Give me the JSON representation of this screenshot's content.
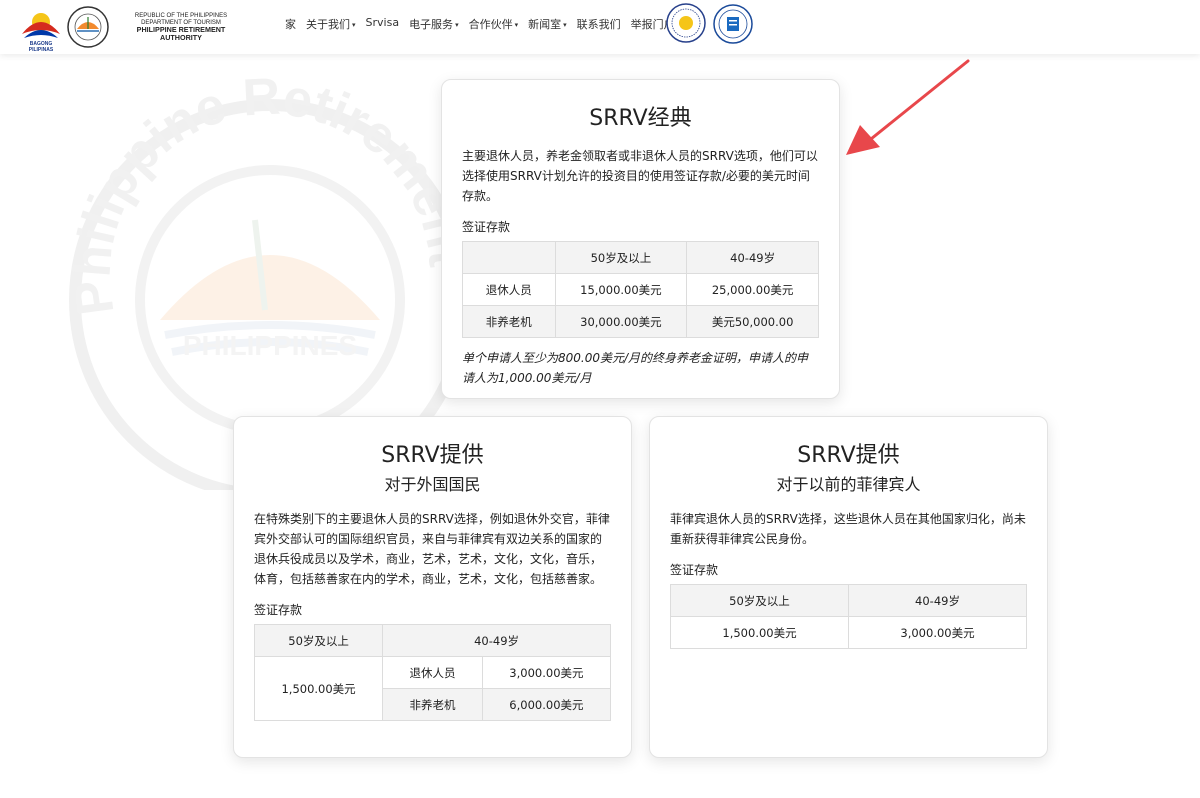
{
  "header": {
    "logo_bp_text": "BAGONG PILIPINAS",
    "org_line1": "REPUBLIC OF THE PHILIPPINES",
    "org_line2": "DEPARTMENT OF TOURISM",
    "org_line3": "PHILIPPINE RETIREMENT AUTHORITY",
    "nav": [
      {
        "label": "家",
        "dropdown": false
      },
      {
        "label": "关于我们",
        "dropdown": true
      },
      {
        "label": "Srvisa",
        "dropdown": false
      },
      {
        "label": "电子服务",
        "dropdown": true
      },
      {
        "label": "合作伙伴",
        "dropdown": true
      },
      {
        "label": "新闻室",
        "dropdown": true
      },
      {
        "label": "联系我们",
        "dropdown": false
      },
      {
        "label": "举报门户",
        "dropdown": false
      }
    ],
    "caret": "▾"
  },
  "watermark": {
    "text1": "Philippine Retirement",
    "text2": "PHILIPPINES"
  },
  "colors": {
    "arrow": "#e8474b",
    "border": "#dcdcdc",
    "header_fill": "#f3f3f3"
  },
  "classic": {
    "title": "SRRV经典",
    "desc": "主要退休人员，养老金领取者或非退休人员的SRRV选项，他们可以选择使用SRRV计划允许的投资目的使用签证存款/必要的美元时间存款。",
    "deposit_label": "签证存款",
    "table": {
      "headers": [
        "",
        "50岁及以上",
        "40-49岁"
      ],
      "rows": [
        [
          "退休人员",
          "15,000.00美元",
          "25,000.00美元"
        ],
        [
          "非养老机",
          "30,000.00美元",
          "美元50,000.00"
        ]
      ]
    },
    "note": "单个申请人至少为800.00美元/月的终身养老金证明，申请人的申请人为1,000.00美元/月"
  },
  "foreign": {
    "title": "SRRV提供",
    "subtitle": "对于外国国民",
    "desc": "在特殊类别下的主要退休人员的SRRV选择，例如退休外交官，菲律宾外交部认可的国际组织官员，来自与菲律宾有双边关系的国家的退休兵役成员以及学术，商业，艺术，艺术，文化，文化，音乐，体育，包括慈善家在内的学术，商业，艺术，文化，包括慈善家。",
    "deposit_label": "签证存款",
    "table": {
      "head_left": "50岁及以上",
      "head_right": "40-49岁",
      "left_value": "1,500.00美元",
      "rows": [
        [
          "退休人员",
          "3,000.00美元"
        ],
        [
          "非养老机",
          "6,000.00美元"
        ]
      ]
    }
  },
  "former": {
    "title": "SRRV提供",
    "subtitle": "对于以前的菲律宾人",
    "desc": "菲律宾退休人员的SRRV选择，这些退休人员在其他国家归化，尚未重新获得菲律宾公民身份。",
    "deposit_label": "签证存款",
    "table": {
      "headers": [
        "50岁及以上",
        "40-49岁"
      ],
      "values": [
        "1,500.00美元",
        "3,000.00美元"
      ]
    }
  }
}
